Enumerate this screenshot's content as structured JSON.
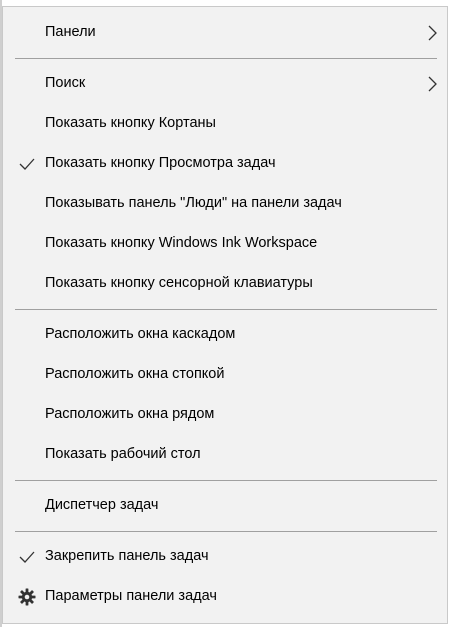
{
  "menu": {
    "items": [
      {
        "label": "Панели",
        "checked": false,
        "submenu": true
      },
      {
        "label": "Поиск",
        "checked": false,
        "submenu": true
      },
      {
        "label": "Показать кнопку Кортаны",
        "checked": false
      },
      {
        "label": "Показать кнопку Просмотра задач",
        "checked": true
      },
      {
        "label": "Показывать панель \"Люди\" на панели задач",
        "checked": false
      },
      {
        "label": "Показать кнопку Windows Ink Workspace",
        "checked": false
      },
      {
        "label": "Показать кнопку сенсорной клавиатуры",
        "checked": false
      },
      {
        "label": "Расположить окна каскадом",
        "checked": false
      },
      {
        "label": "Расположить окна стопкой",
        "checked": false
      },
      {
        "label": "Расположить окна рядом",
        "checked": false
      },
      {
        "label": "Показать рабочий стол",
        "checked": false
      },
      {
        "label": "Диспетчер задач",
        "checked": false
      },
      {
        "label": "Закрепить панель задач",
        "checked": true
      },
      {
        "label": "Параметры панели задач",
        "checked": false,
        "icon": "gear-icon"
      }
    ]
  },
  "icons": {
    "check": "checkmark-icon",
    "submenu": "chevron-right-icon",
    "settings": "gear-icon"
  },
  "colors": {
    "menu_background": "#f2f2f2",
    "separator": "#a0a0a0",
    "text": "#000000"
  }
}
